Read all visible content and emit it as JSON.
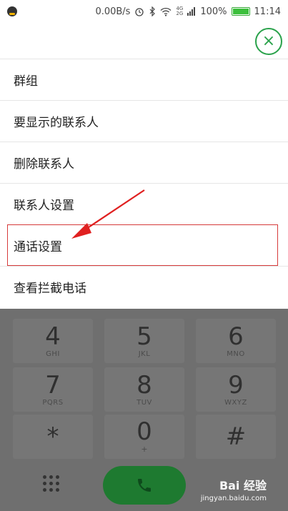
{
  "status_bar": {
    "speed": "0.00B/s",
    "net_top": "4G",
    "net_bottom": "2G",
    "battery": "100%",
    "time": "11:14",
    "battery_level": 1.0
  },
  "topbar": {
    "close_icon": "×"
  },
  "menu": {
    "items": [
      {
        "label": "群组"
      },
      {
        "label": "要显示的联系人"
      },
      {
        "label": "删除联系人"
      },
      {
        "label": "联系人设置"
      },
      {
        "label": "通话设置"
      },
      {
        "label": "查看拦截电话"
      }
    ]
  },
  "keypad": {
    "keys": [
      {
        "digit": "4",
        "letters": "GHI"
      },
      {
        "digit": "5",
        "letters": "JKL"
      },
      {
        "digit": "6",
        "letters": "MNO"
      },
      {
        "digit": "7",
        "letters": "PQRS"
      },
      {
        "digit": "8",
        "letters": "TUV"
      },
      {
        "digit": "9",
        "letters": "WXYZ"
      },
      {
        "digit": "*",
        "letters": ""
      },
      {
        "digit": "0",
        "letters": "+"
      },
      {
        "digit": "#",
        "letters": ""
      }
    ]
  },
  "watermark": {
    "brand": "Bai 经验",
    "url": "jingyan.baidu.com"
  },
  "colors": {
    "accent": "#2aa24b",
    "highlight_box": "#d63a3a",
    "call_button": "#1e7a30"
  }
}
